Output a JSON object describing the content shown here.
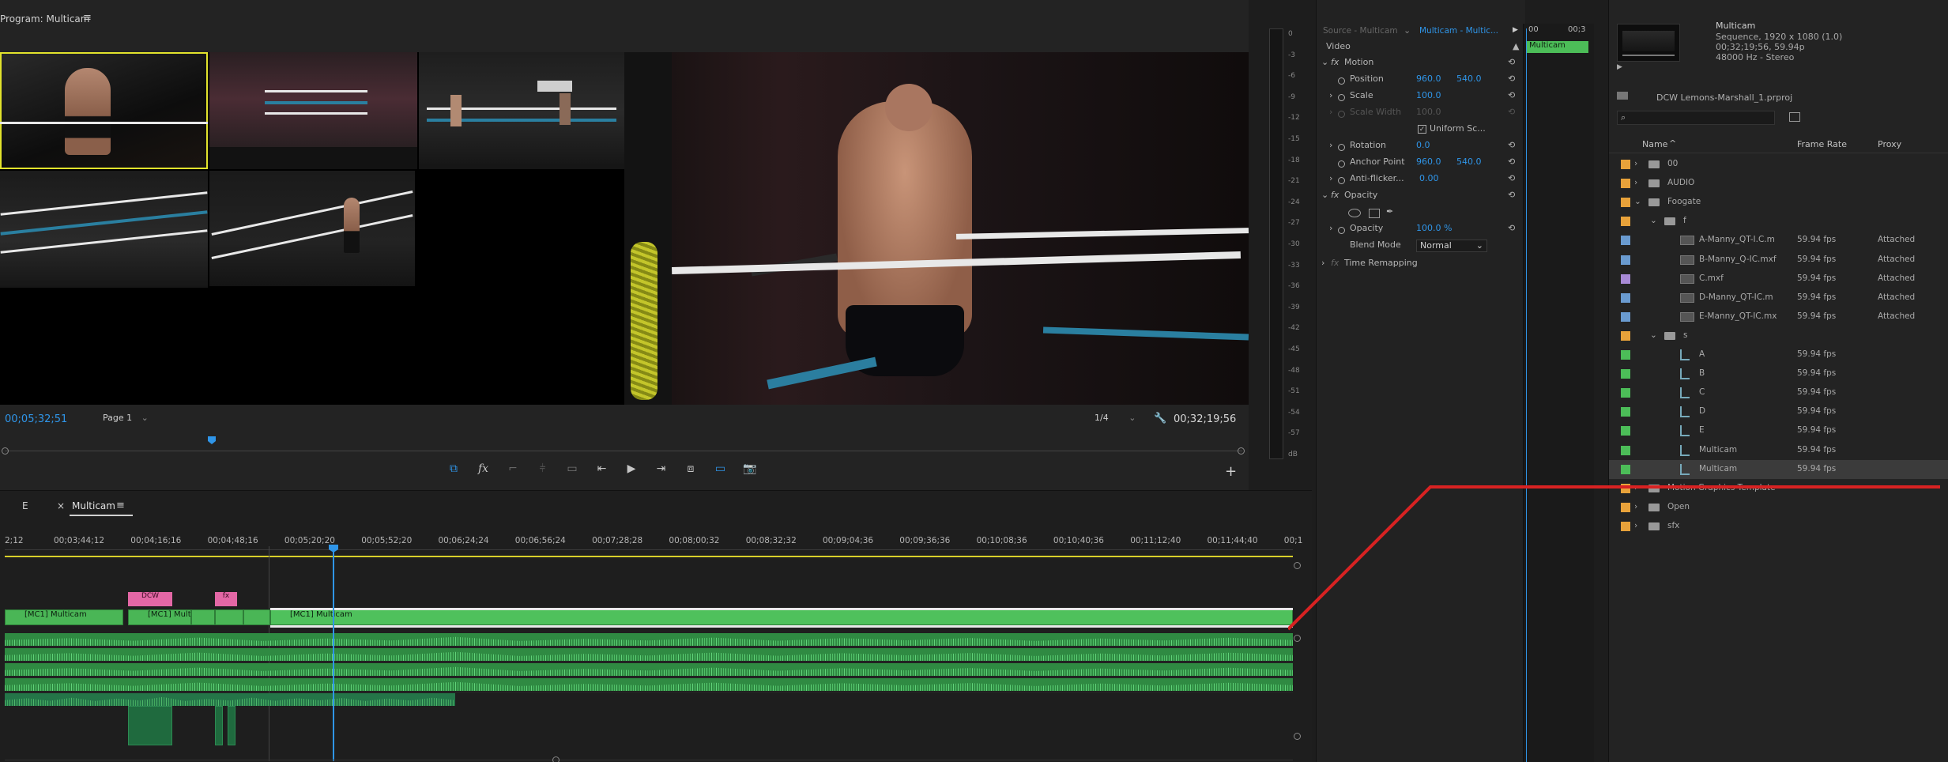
{
  "program": {
    "title": "Program: Multicam",
    "menu_icon": "≡",
    "timecode_left": "00;05;32;51",
    "page_select": "Page 1",
    "zoom_select": "1/4",
    "timecode_right": "00;32;19;56",
    "transport_icons": [
      "multicam-icon",
      "fx-icon",
      "lift-icon",
      "extract-icon",
      "safe-margins-icon",
      "step-back-icon",
      "play-icon",
      "step-forward-icon",
      "insert-icon",
      "overwrite-icon",
      "camera-icon"
    ],
    "fx_label": "fx"
  },
  "meters": {
    "db_labels": [
      "0",
      "-3",
      "-6",
      "-9",
      "-12",
      "-15",
      "-18",
      "-21",
      "-24",
      "-27",
      "-30",
      "-33",
      "-36",
      "-39",
      "-42",
      "-45",
      "-48",
      "-51",
      "-54",
      "-57",
      "dB"
    ]
  },
  "effect_controls": {
    "tab_source": "Source - Multicam",
    "tab_sequence": "Multicam - Multic...",
    "section_video": "Video",
    "motion": "Motion",
    "position_label": "Position",
    "position_x": "960.0",
    "position_y": "540.0",
    "scale_label": "Scale",
    "scale_val": "100.0",
    "scale_width_label": "Scale Width",
    "scale_width_val": "100.0",
    "uniform_scale": "Uniform Sc...",
    "rotation_label": "Rotation",
    "rotation_val": "0.0",
    "anchor_label": "Anchor Point",
    "anchor_x": "960.0",
    "anchor_y": "540.0",
    "antiflicker_label": "Anti-flicker...",
    "antiflicker_val": "0.00",
    "opacity_section": "Opacity",
    "opacity_label": "Opacity",
    "opacity_val": "100.0 %",
    "blend_label": "Blend Mode",
    "blend_val": "Normal",
    "time_remap": "Time Remapping",
    "ec_timecode_a": "00",
    "ec_timecode_b": "00;3",
    "ec_clip": "Multicam"
  },
  "project": {
    "seq_name": "Multicam",
    "seq_info1": "Sequence, 1920 x 1080 (1.0)",
    "seq_info2": "00;32;19;56, 59.94p",
    "seq_info3": "48000 Hz - Stereo",
    "file": "DCW Lemons-Marshall_1.prproj",
    "col_name": "Name",
    "col_rate": "Frame Rate",
    "col_proxy": "Proxy",
    "rows": [
      {
        "name": "00",
        "rate": "",
        "proxy": "",
        "color": "#e8a23a",
        "indent": 0,
        "kind": "folder",
        "arrow": "›"
      },
      {
        "name": "AUDIO",
        "rate": "",
        "proxy": "",
        "color": "#e8a23a",
        "indent": 0,
        "kind": "folder",
        "arrow": "›"
      },
      {
        "name": "Foogate",
        "rate": "",
        "proxy": "",
        "color": "#e8a23a",
        "indent": 0,
        "kind": "folder",
        "arrow": "⌄"
      },
      {
        "name": "f",
        "rate": "",
        "proxy": "",
        "color": "#e8a23a",
        "indent": 1,
        "kind": "folder",
        "arrow": "⌄"
      },
      {
        "name": "A-Manny_QT-I.C.m",
        "rate": "59.94 fps",
        "proxy": "Attached",
        "color": "#6a9bd0",
        "indent": 2,
        "kind": "clip",
        "arrow": ""
      },
      {
        "name": "B-Manny_Q-IC.mxf",
        "rate": "59.94 fps",
        "proxy": "Attached",
        "color": "#6a9bd0",
        "indent": 2,
        "kind": "clip",
        "arrow": ""
      },
      {
        "name": "C.mxf",
        "rate": "59.94 fps",
        "proxy": "Attached",
        "color": "#a88ad6",
        "indent": 2,
        "kind": "clip",
        "arrow": ""
      },
      {
        "name": "D-Manny_QT-IC.m",
        "rate": "59.94 fps",
        "proxy": "Attached",
        "color": "#6a9bd0",
        "indent": 2,
        "kind": "clip",
        "arrow": ""
      },
      {
        "name": "E-Manny_QT-IC.mx",
        "rate": "59.94 fps",
        "proxy": "Attached",
        "color": "#6a9bd0",
        "indent": 2,
        "kind": "clip",
        "arrow": ""
      },
      {
        "name": "s",
        "rate": "",
        "proxy": "",
        "color": "#e8a23a",
        "indent": 1,
        "kind": "folder",
        "arrow": "⌄"
      },
      {
        "name": "A",
        "rate": "59.94 fps",
        "proxy": "",
        "color": "#4cbd58",
        "indent": 2,
        "kind": "seq",
        "arrow": ""
      },
      {
        "name": "B",
        "rate": "59.94 fps",
        "proxy": "",
        "color": "#4cbd58",
        "indent": 2,
        "kind": "seq",
        "arrow": ""
      },
      {
        "name": "C",
        "rate": "59.94 fps",
        "proxy": "",
        "color": "#4cbd58",
        "indent": 2,
        "kind": "seq",
        "arrow": ""
      },
      {
        "name": "D",
        "rate": "59.94 fps",
        "proxy": "",
        "color": "#4cbd58",
        "indent": 2,
        "kind": "seq",
        "arrow": ""
      },
      {
        "name": "E",
        "rate": "59.94 fps",
        "proxy": "",
        "color": "#4cbd58",
        "indent": 2,
        "kind": "seq",
        "arrow": ""
      },
      {
        "name": "Multicam",
        "rate": "59.94 fps",
        "proxy": "",
        "color": "#4cbd58",
        "indent": 2,
        "kind": "seq",
        "arrow": ""
      },
      {
        "name": "Multicam",
        "rate": "59.94 fps",
        "proxy": "",
        "color": "#4cbd58",
        "indent": 2,
        "kind": "seq",
        "arrow": "",
        "selected": true
      },
      {
        "name": "Motion Graphics Template",
        "rate": "",
        "proxy": "",
        "color": "#e8a23a",
        "indent": 0,
        "kind": "folder",
        "arrow": "›"
      },
      {
        "name": "Open",
        "rate": "",
        "proxy": "",
        "color": "#e8a23a",
        "indent": 0,
        "kind": "folder",
        "arrow": "›"
      },
      {
        "name": "sfx",
        "rate": "",
        "proxy": "",
        "color": "#e8a23a",
        "indent": 0,
        "kind": "folder",
        "arrow": "›"
      }
    ]
  },
  "timeline": {
    "tab_e": "E",
    "tab_close": "×",
    "tab_multicam": "Multicam",
    "tab_menu": "≡",
    "ruler": [
      "2;12",
      "00;03;44;12",
      "00;04;16;16",
      "00;04;48;16",
      "00;05;20;20",
      "00;05;52;20",
      "00;06;24;24",
      "00;06;56;24",
      "00;07;28;28",
      "00;08;00;32",
      "00;08;32;32",
      "00;09;04;36",
      "00;09;36;36",
      "00;10;08;36",
      "00;10;40;36",
      "00;11;12;40",
      "00;11;44;40",
      "00;1"
    ],
    "clip_a": "[MC1] Multicam",
    "clip_b": "[MC1] Mult",
    "clip_c": "[MC1] Multicam",
    "pink_a": "DCW",
    "pink_b": "fx"
  }
}
